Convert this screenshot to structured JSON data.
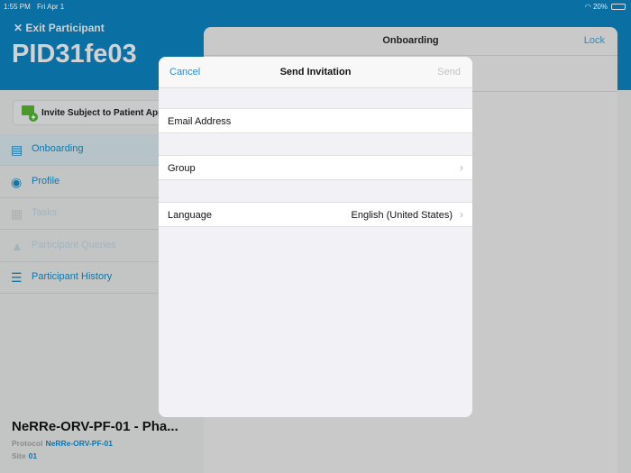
{
  "status": {
    "time": "1:55 PM",
    "date": "Fri Apr 1",
    "battery": "20%"
  },
  "participant": {
    "exit_label": "✕ Exit Participant",
    "id": "PID31fe03",
    "invite_label": "Invite Subject to Patient App"
  },
  "nav": [
    {
      "label": "Onboarding",
      "icon": "clipboard-icon"
    },
    {
      "label": "Profile",
      "icon": "person-icon"
    },
    {
      "label": "Tasks",
      "icon": "calendar-icon"
    },
    {
      "label": "Participant Queries",
      "icon": "queries-icon"
    },
    {
      "label": "Participant History",
      "icon": "history-icon"
    }
  ],
  "study": {
    "title": "NeRRe-ORV-PF-01 - Pha...",
    "protocol_label": "Protocol",
    "protocol": "NeRRe-ORV-PF-01",
    "site_label": "Site",
    "site": "01"
  },
  "sheet": {
    "title": "Onboarding",
    "lock": "Lock"
  },
  "modal": {
    "cancel": "Cancel",
    "title": "Send Invitation",
    "send": "Send",
    "email_label": "Email Address",
    "group_label": "Group",
    "language_label": "Language",
    "language_value": "English (United States)"
  }
}
